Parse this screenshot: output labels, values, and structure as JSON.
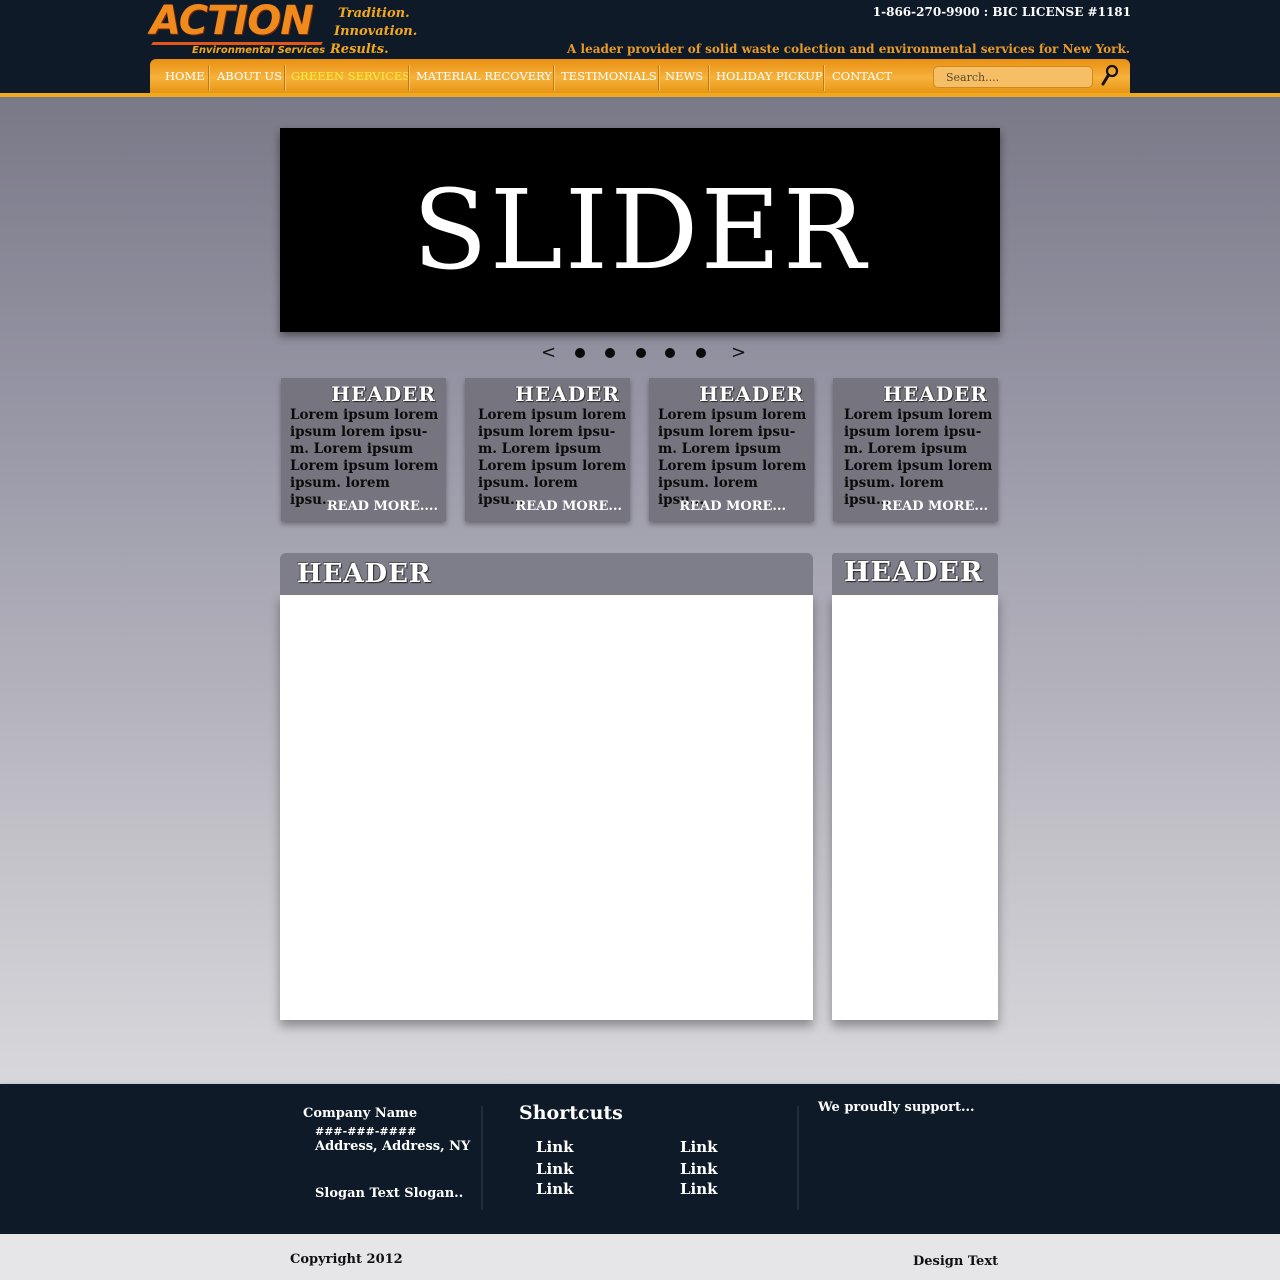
{
  "header": {
    "logo": {
      "word": "ACTION",
      "subtitle": "Environmental Services"
    },
    "taglines": [
      "Tradition.",
      "Innovation.",
      "Results."
    ],
    "phone_license": "1-866-270-9900 : BIC LICENSE #1181",
    "leader_text": "A leader provider of solid waste colection and environmental services for New York."
  },
  "nav": {
    "items": [
      {
        "label": "HOME"
      },
      {
        "label": "ABOUT US"
      },
      {
        "label": "GREEEN SERVICES",
        "active": true
      },
      {
        "label": "MATERIAL RECOVERY"
      },
      {
        "label": "TESTIMONIALS"
      },
      {
        "label": "NEWS"
      },
      {
        "label": "HOLIDAY PICKUP"
      },
      {
        "label": "CONTACT"
      }
    ],
    "search_placeholder": "Search....",
    "search_icon": "magnifier-icon"
  },
  "slider": {
    "title": "SLIDER",
    "prev_label": "<",
    "next_label": ">",
    "dot_count": 5
  },
  "cards": [
    {
      "header": "HEADER",
      "body": "Lorem ipsum lorem\nipsum lorem ipsu-\nm. Lorem ipsum\nLorem ipsum lorem\nipsum. lorem ipsu...",
      "more": "READ MORE...."
    },
    {
      "header": "HEADER",
      "body": "Lorem ipsum lorem\nipsum lorem ipsu-\nm. Lorem ipsum\nLorem ipsum lorem\nipsum. lorem ipsu...",
      "more": "READ MORE..."
    },
    {
      "header": "HEADER",
      "body": "Lorem ipsum lorem\nipsum lorem ipsu-\nm. Lorem ipsum\nLorem ipsum lorem\nipsum. lorem ipsu...",
      "more": "READ MORE..."
    },
    {
      "header": "HEADER",
      "body": "Lorem ipsum lorem\nipsum lorem ipsu-\nm. Lorem ipsum\nLorem ipsum lorem\nipsum. lorem ipsu...",
      "more": "READ MORE..."
    }
  ],
  "main_panel": {
    "header": "HEADER"
  },
  "side_panel": {
    "header": "HEADER"
  },
  "footer": {
    "company_name": "Company Name",
    "phone": "###-###-####",
    "address": "Address, Address, NY",
    "slogan": "Slogan Text Slogan..",
    "shortcuts_title": "Shortcuts",
    "links": [
      "Link",
      "Link",
      "Link",
      "Link",
      "Link",
      "Link"
    ],
    "support_text": "We proudly support..."
  },
  "bottom": {
    "copyright": "Copyright 2012",
    "design": "Design Text"
  },
  "colors": {
    "header_bg": "#0f1a28",
    "accent_orange": "#f2a81e",
    "nav_active": "#f6ef36",
    "card_bg": "#76757f",
    "panel_head_bg": "#7e7d8a"
  }
}
